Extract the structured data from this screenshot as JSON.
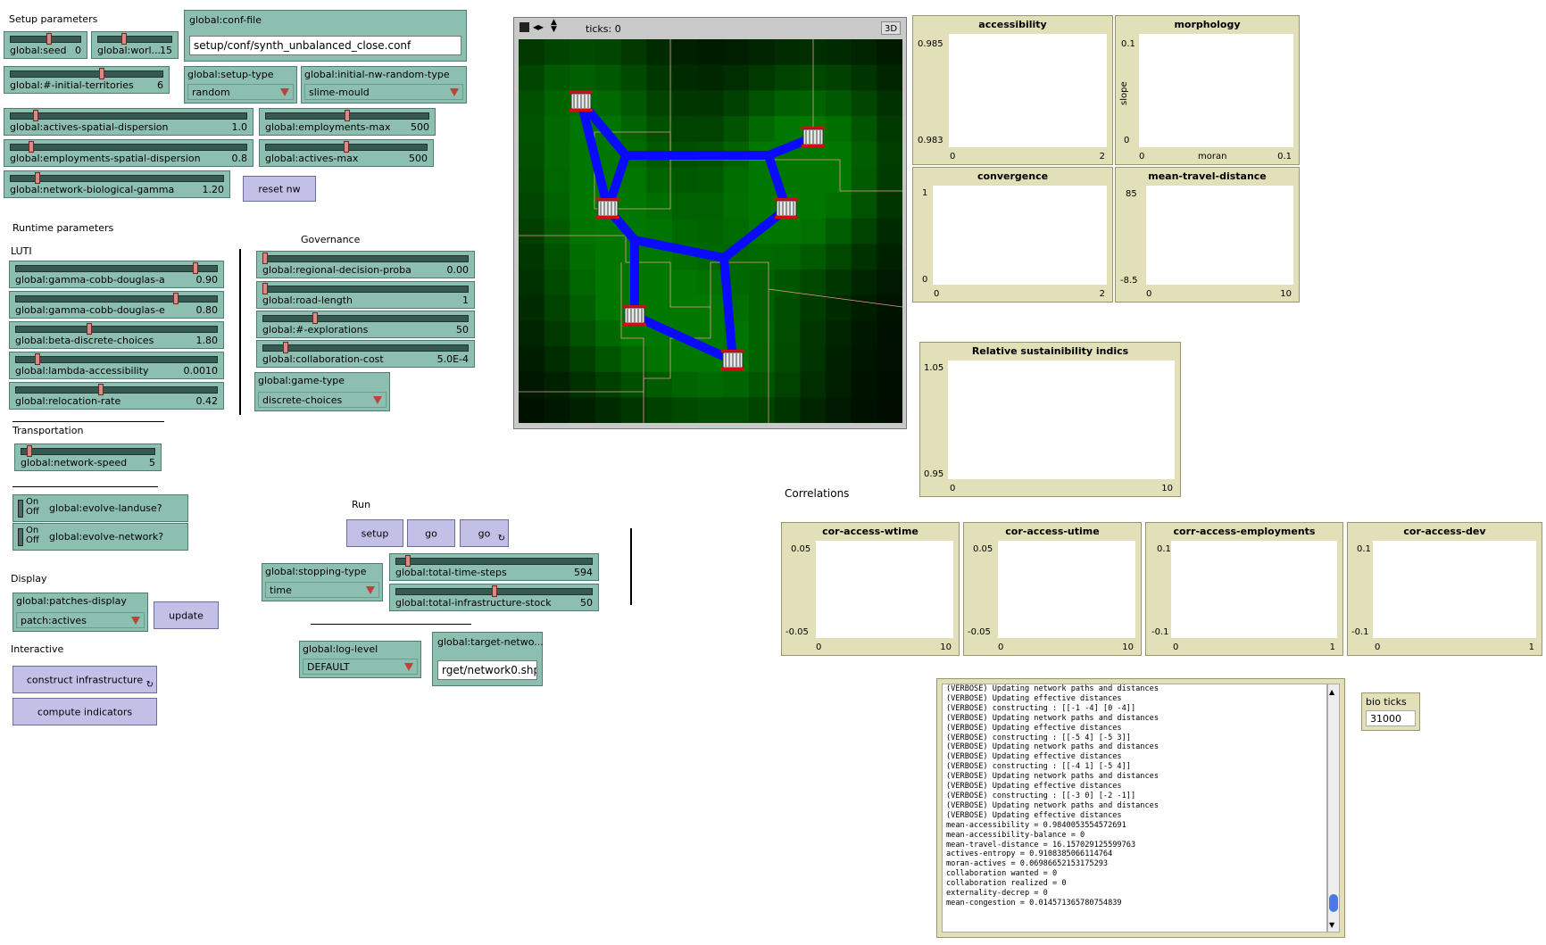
{
  "sections": {
    "setup": "Setup parameters",
    "runtime": "Runtime parameters",
    "luti": "LUTI",
    "governance": "Governance",
    "transportation": "Transportation",
    "display": "Display",
    "interactive": "Interactive",
    "run": "Run",
    "correlations": "Correlations"
  },
  "sliders": {
    "seed": {
      "name": "global:seed",
      "value": "0",
      "fraction": 0.55
    },
    "world": {
      "name": "global:worl...",
      "value": "15",
      "fraction": 0.35
    },
    "territories": {
      "name": "global:#-initial-territories",
      "value": "6",
      "fraction": 0.6
    },
    "actives_disp": {
      "name": "global:actives-spatial-dispersion",
      "value": "1.0",
      "fraction": 0.1
    },
    "employments_max": {
      "name": "global:employments-max",
      "value": "500",
      "fraction": 0.5
    },
    "employments_disp": {
      "name": "global:employments-spatial-dispersion",
      "value": "0.8",
      "fraction": 0.08
    },
    "actives_max": {
      "name": "global:actives-max",
      "value": "500",
      "fraction": 0.5
    },
    "gamma": {
      "name": "global:network-biological-gamma",
      "value": "1.20",
      "fraction": 0.12
    },
    "cobb_a": {
      "name": "global:gamma-cobb-douglas-a",
      "value": "0.90",
      "fraction": 0.9
    },
    "cobb_e": {
      "name": "global:gamma-cobb-douglas-e",
      "value": "0.80",
      "fraction": 0.8
    },
    "beta": {
      "name": "global:beta-discrete-choices",
      "value": "1.80",
      "fraction": 0.36
    },
    "lambda": {
      "name": "global:lambda-accessibility",
      "value": "0.0010",
      "fraction": 0.1
    },
    "relocation": {
      "name": "global:relocation-rate",
      "value": "0.42",
      "fraction": 0.42
    },
    "regional": {
      "name": "global:regional-decision-proba",
      "value": "0.00",
      "fraction": 0.0
    },
    "road_length": {
      "name": "global:road-length",
      "value": "1",
      "fraction": 0.0
    },
    "explorations": {
      "name": "global:#-explorations",
      "value": "50",
      "fraction": 0.25
    },
    "collab_cost": {
      "name": "global:collaboration-cost",
      "value": "5.0E-4",
      "fraction": 0.1
    },
    "network_speed": {
      "name": "global:network-speed",
      "value": "5",
      "fraction": 0.05
    },
    "time_steps": {
      "name": "global:total-time-steps",
      "value": "594",
      "fraction": 0.05
    },
    "infra_stock": {
      "name": "global:total-infrastructure-stock",
      "value": "50",
      "fraction": 0.5
    }
  },
  "choosers": {
    "setup_type": {
      "name": "global:setup-type",
      "value": "random"
    },
    "initial_nw": {
      "name": "global:initial-nw-random-type",
      "value": "slime-mould"
    },
    "game_type": {
      "name": "global:game-type",
      "value": "discrete-choices"
    },
    "stopping_type": {
      "name": "global:stopping-type",
      "value": "time"
    },
    "patches_display": {
      "name": "global:patches-display",
      "value": "patch:actives"
    },
    "log_level": {
      "name": "global:log-level",
      "value": "DEFAULT"
    }
  },
  "inputs": {
    "conf_file": {
      "name": "global:conf-file",
      "value": "setup/conf/synth_unbalanced_close.conf"
    },
    "target_network": {
      "name": "global:target-netwo...",
      "value": "rget/network0.shp"
    }
  },
  "buttons": {
    "reset_nw": "reset nw",
    "setup": "setup",
    "go": "go",
    "go_forever": "go",
    "update": "update",
    "construct": "construct infrastructure",
    "compute": "compute indicators"
  },
  "switches": {
    "evolve_landuse": {
      "name": "global:evolve-landuse?",
      "on": "On",
      "off": "Off"
    },
    "evolve_network": {
      "name": "global:evolve-network?",
      "on": "On",
      "off": "Off"
    }
  },
  "view": {
    "ticks": "ticks: 0",
    "three_d": "3D"
  },
  "plots": {
    "accessibility": {
      "title": "accessibility",
      "ymax": "0.985",
      "ymin": "0.983",
      "xmin": "0",
      "xmax": "2"
    },
    "morphology": {
      "title": "morphology",
      "ymax": "0.1",
      "ymin": "0",
      "xmin": "0",
      "xmax": "0.1",
      "xlabel": "moran",
      "ylabel": "slope"
    },
    "convergence": {
      "title": "convergence",
      "ymax": "1",
      "ymin": "0",
      "xmin": "0",
      "xmax": "2"
    },
    "travel": {
      "title": "mean-travel-distance",
      "ymax": "85",
      "ymin": "-8.5",
      "xmin": "0",
      "xmax": "10"
    },
    "sustain": {
      "title": "Relative sustainibility indics",
      "ymax": "1.05",
      "ymin": "0.95",
      "xmin": "0",
      "xmax": "10"
    },
    "wtime": {
      "title": "cor-access-wtime",
      "ymax": "0.05",
      "ymin": "-0.05",
      "xmin": "0",
      "xmax": "10"
    },
    "utime": {
      "title": "cor-access-utime",
      "ymax": "0.05",
      "ymin": "-0.05",
      "xmin": "0",
      "xmax": "10"
    },
    "employments": {
      "title": "corr-access-employments",
      "ymax": "0.1",
      "ymin": "-0.1",
      "xmin": "0",
      "xmax": "1"
    },
    "dev": {
      "title": "cor-access-dev",
      "ymax": "0.1",
      "ymin": "-0.1",
      "xmin": "0",
      "xmax": "1"
    }
  },
  "monitor": {
    "name": "bio ticks",
    "value": "31000"
  },
  "output_lines": [
    "(VERBOSE) Updating network paths and distances",
    "(VERBOSE) Updating effective distances",
    "(VERBOSE) constructing : [[-1 -4] [0 -4]]",
    "(VERBOSE) Updating network paths and distances",
    "(VERBOSE) Updating effective distances",
    "(VERBOSE) constructing : [[-5 4] [-5 3]]",
    "(VERBOSE) Updating network paths and distances",
    "(VERBOSE) Updating effective distances",
    "(VERBOSE) constructing : [[-4 1] [-5 4]]",
    "(VERBOSE) Updating network paths and distances",
    "(VERBOSE) Updating effective distances",
    "(VERBOSE) constructing : [[-3 0] [-2 -1]]",
    "(VERBOSE) Updating network paths and distances",
    "(VERBOSE) Updating effective distances",
    "mean-accessibility = 0.9840053554572691",
    "mean-accessibility-balance = 0",
    "mean-travel-distance = 16.157029125599763",
    "actives-entropy = 0.9108385066114764",
    "moran-actives = 0.06986652153175293",
    "collaboration wanted = 0",
    "collaboration realized = 0",
    "externality-decrep = 0",
    "mean-congestion = 0.014571365780754839"
  ],
  "colors": {
    "widget": "#8dbfb0",
    "button": "#c3c0e8",
    "plot": "#e2e0b8",
    "road": "#0a0aff",
    "border": "#e89a9a"
  }
}
